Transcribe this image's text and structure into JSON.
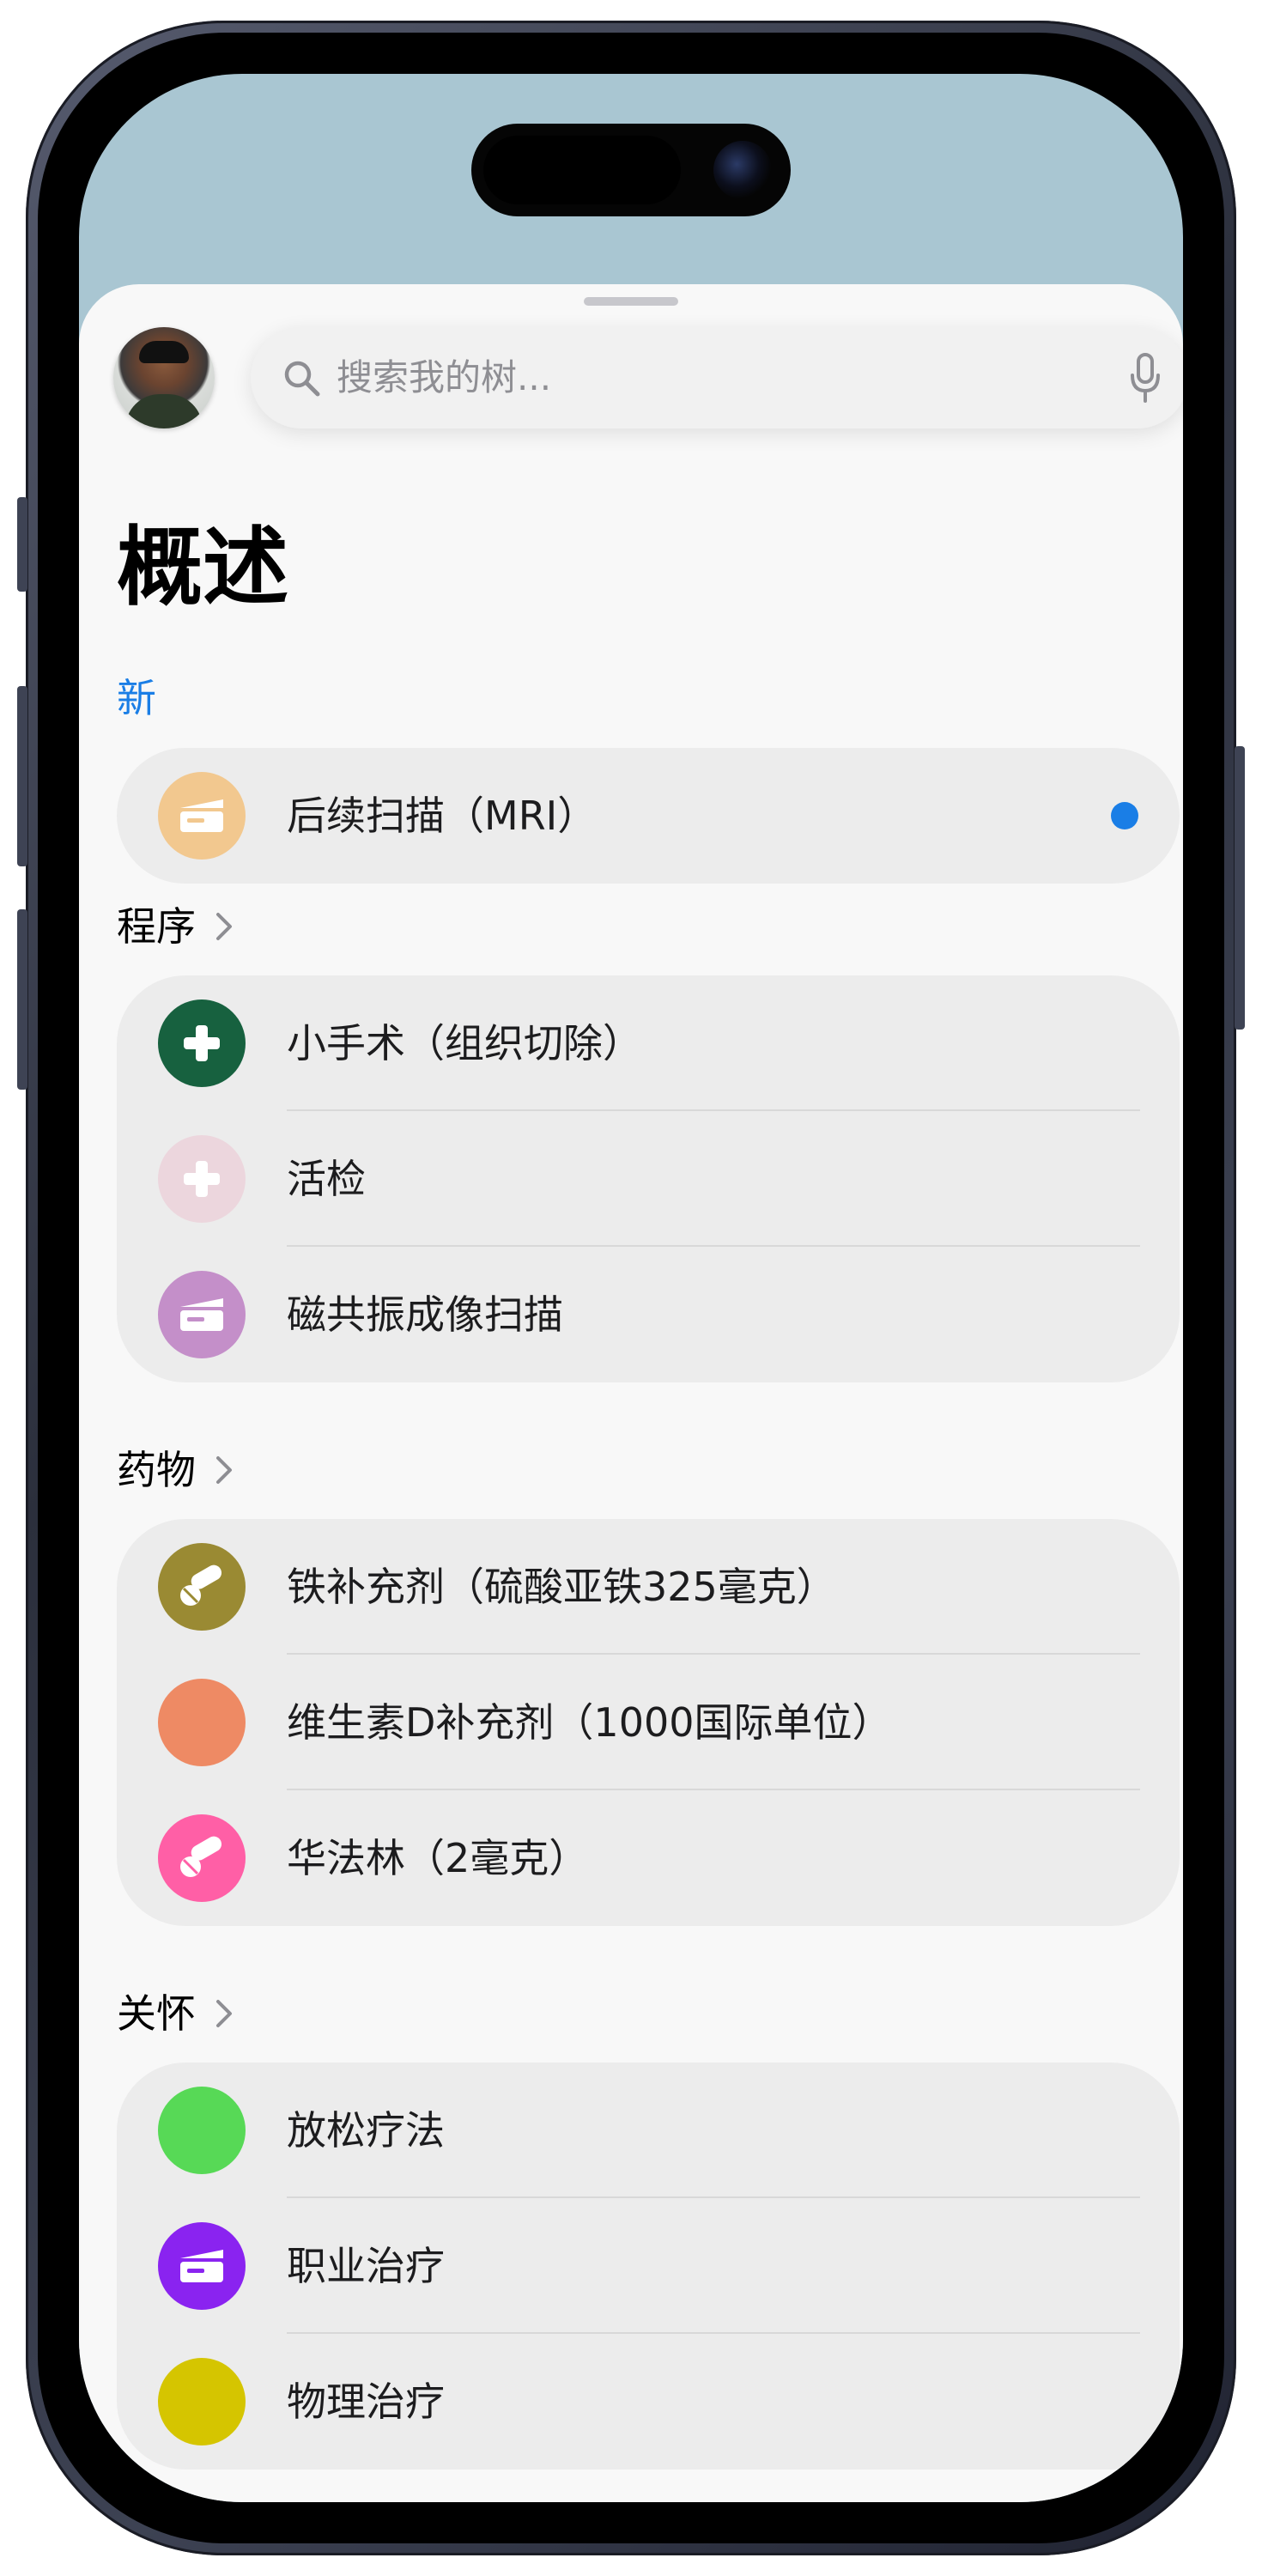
{
  "search": {
    "placeholder": "搜索我的树..."
  },
  "page_title": "概述",
  "new_section": {
    "label": "新",
    "items": [
      {
        "label": "后续扫描（MRI）",
        "icon": "scanner-icon",
        "color": "#f2c88f",
        "unread": true
      }
    ]
  },
  "procedures": {
    "label": "程序",
    "items": [
      {
        "label": "小手术（组织切除）",
        "icon": "medical-cross-icon",
        "color": "#17613f"
      },
      {
        "label": "活检",
        "icon": "medical-cross-icon",
        "color": "#ecd6dd"
      },
      {
        "label": "磁共振成像扫描",
        "icon": "scanner-icon",
        "color": "#c48fc9"
      }
    ]
  },
  "medications": {
    "label": "药物",
    "items": [
      {
        "label": "铁补充剂（硫酸亚铁325毫克）",
        "icon": "pills-icon",
        "color": "#9a8a33"
      },
      {
        "label": "维生素D补充剂（1000国际单位）",
        "icon": "circle-icon",
        "color": "#ee8a64"
      },
      {
        "label": "华法林（2毫克）",
        "icon": "pills-icon",
        "color": "#ff5fa6"
      }
    ]
  },
  "care": {
    "label": "关怀",
    "items": [
      {
        "label": "放松疗法",
        "icon": "circle-icon",
        "color": "#57d956"
      },
      {
        "label": "职业治疗",
        "icon": "scanner-icon",
        "color": "#8a23f0"
      },
      {
        "label": "物理治疗",
        "icon": "circle-icon",
        "color": "#d5c500"
      }
    ]
  },
  "colors": {
    "accent": "#1a7ee6",
    "sky": "#a9c6d2",
    "card": "#ececec"
  }
}
